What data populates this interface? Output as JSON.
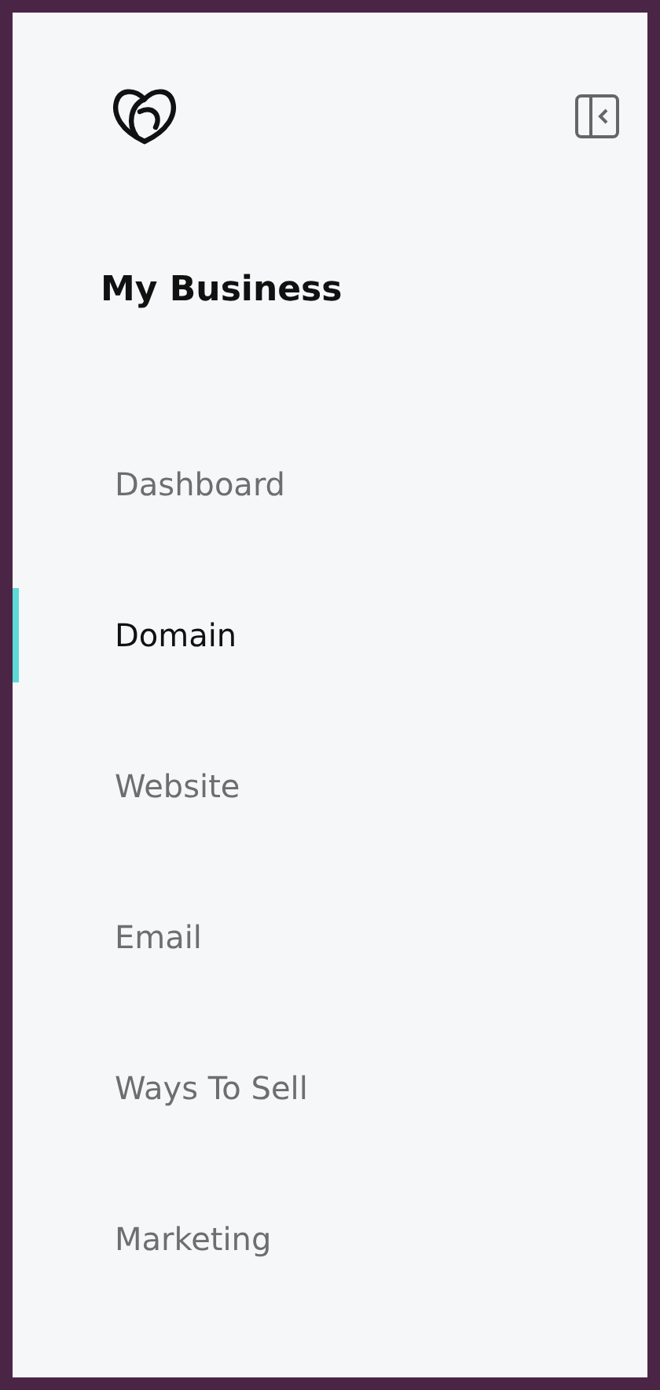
{
  "sidebar": {
    "title": "My Business",
    "items": [
      {
        "label": "Dashboard",
        "selected": false
      },
      {
        "label": "Domain",
        "selected": true
      },
      {
        "label": "Website",
        "selected": false
      },
      {
        "label": "Email",
        "selected": false
      },
      {
        "label": "Ways To Sell",
        "selected": false
      },
      {
        "label": "Marketing",
        "selected": false
      }
    ]
  }
}
